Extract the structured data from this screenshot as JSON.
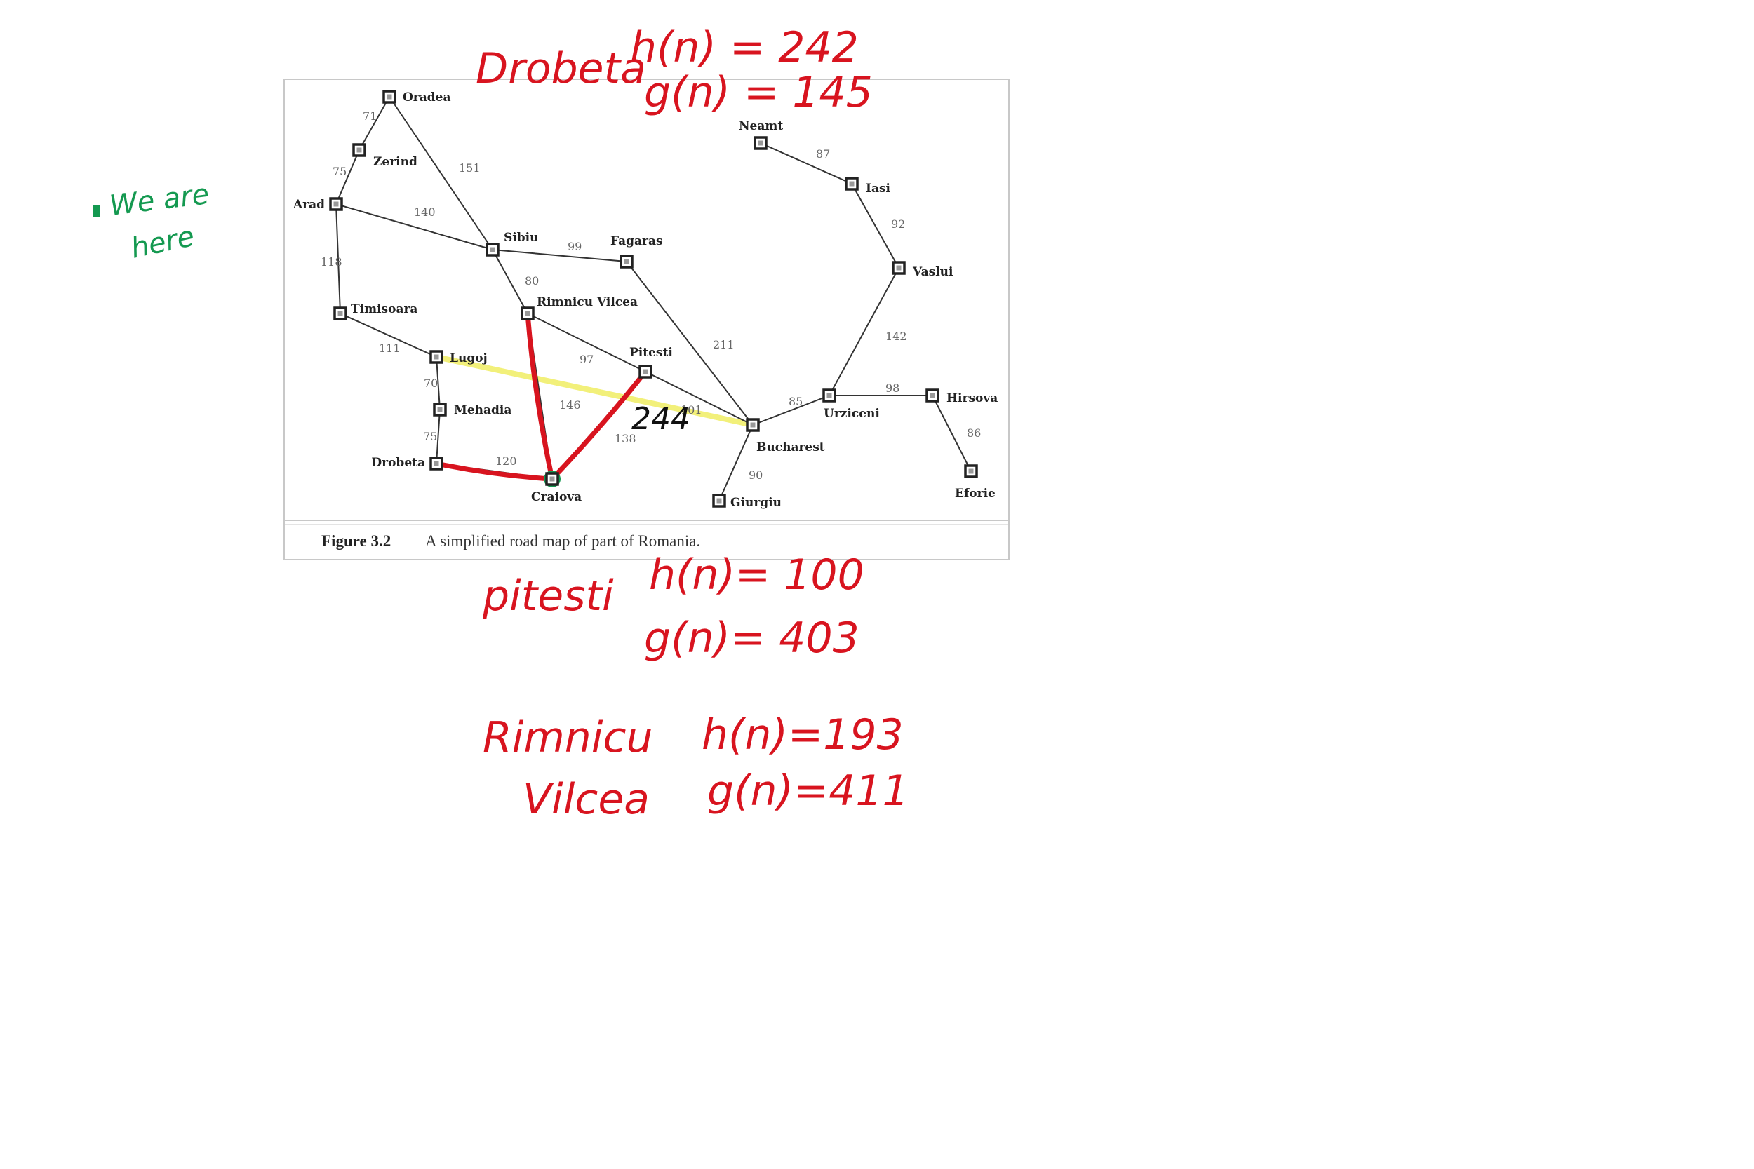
{
  "figure": {
    "number": "Figure 3.2",
    "caption": "A simplified road map of part of Romania."
  },
  "cities": [
    {
      "id": "oradea",
      "name": "Oradea"
    },
    {
      "id": "zerind",
      "name": "Zerind"
    },
    {
      "id": "arad",
      "name": "Arad"
    },
    {
      "id": "sibiu",
      "name": "Sibiu"
    },
    {
      "id": "fagaras",
      "name": "Fagaras"
    },
    {
      "id": "timisoara",
      "name": "Timisoara"
    },
    {
      "id": "rimnicu",
      "name": "Rimnicu Vilcea"
    },
    {
      "id": "lugoj",
      "name": "Lugoj"
    },
    {
      "id": "pitesti",
      "name": "Pitesti"
    },
    {
      "id": "mehadia",
      "name": "Mehadia"
    },
    {
      "id": "drobeta",
      "name": "Drobeta"
    },
    {
      "id": "craiova",
      "name": "Craiova"
    },
    {
      "id": "bucharest",
      "name": "Bucharest"
    },
    {
      "id": "giurgiu",
      "name": "Giurgiu"
    },
    {
      "id": "urziceni",
      "name": "Urziceni"
    },
    {
      "id": "hirsova",
      "name": "Hirsova"
    },
    {
      "id": "eforie",
      "name": "Eforie"
    },
    {
      "id": "vaslui",
      "name": "Vaslui"
    },
    {
      "id": "iasi",
      "name": "Iasi"
    },
    {
      "id": "neamt",
      "name": "Neamt"
    }
  ],
  "roads": [
    {
      "from": "oradea",
      "to": "zerind",
      "distance": "71"
    },
    {
      "from": "zerind",
      "to": "arad",
      "distance": "75"
    },
    {
      "from": "oradea",
      "to": "sibiu",
      "distance": "151"
    },
    {
      "from": "arad",
      "to": "sibiu",
      "distance": "140"
    },
    {
      "from": "arad",
      "to": "timisoara",
      "distance": "118"
    },
    {
      "from": "sibiu",
      "to": "fagaras",
      "distance": "99"
    },
    {
      "from": "sibiu",
      "to": "rimnicu",
      "distance": "80"
    },
    {
      "from": "timisoara",
      "to": "lugoj",
      "distance": "111"
    },
    {
      "from": "rimnicu",
      "to": "pitesti",
      "distance": "97"
    },
    {
      "from": "lugoj",
      "to": "mehadia",
      "distance": "70"
    },
    {
      "from": "rimnicu",
      "to": "craiova",
      "distance": "146"
    },
    {
      "from": "fagaras",
      "to": "bucharest",
      "distance": "211"
    },
    {
      "from": "pitesti",
      "to": "bucharest",
      "distance": "101"
    },
    {
      "from": "mehadia",
      "to": "drobeta",
      "distance": "75"
    },
    {
      "from": "pitesti",
      "to": "craiova",
      "distance": "138"
    },
    {
      "from": "drobeta",
      "to": "craiova",
      "distance": "120"
    },
    {
      "from": "bucharest",
      "to": "urziceni",
      "distance": "85"
    },
    {
      "from": "bucharest",
      "to": "giurgiu",
      "distance": "90"
    },
    {
      "from": "urziceni",
      "to": "hirsova",
      "distance": "98"
    },
    {
      "from": "hirsova",
      "to": "eforie",
      "distance": "86"
    },
    {
      "from": "urziceni",
      "to": "vaslui",
      "distance": "142"
    },
    {
      "from": "vaslui",
      "to": "iasi",
      "distance": "92"
    },
    {
      "from": "iasi",
      "to": "neamt",
      "distance": "87"
    }
  ],
  "highlighted_paths": {
    "red": [
      [
        "drobeta",
        "craiova"
      ],
      [
        "craiova",
        "rimnicu"
      ],
      [
        "craiova",
        "pitesti"
      ]
    ],
    "yellow": [
      [
        "lugoj",
        "bucharest"
      ]
    ],
    "current_node": "craiova"
  },
  "annotations": {
    "we_are_here_line1": "We are",
    "we_are_here_line2": "here",
    "straight_line_value": "244",
    "drobeta_name": "Drobeta",
    "drobeta_h": "h(n) = 242",
    "drobeta_g": "g(n) = 145",
    "pitesti_name": "pitesti",
    "pitesti_h": "h(n)= 100",
    "pitesti_g": "g(n)= 403",
    "rimnicu_name_1": "Rimnicu",
    "rimnicu_name_2": "Vilcea",
    "rimnicu_h": "h(n)=193",
    "rimnicu_g": "g(n)=411"
  },
  "colors": {
    "red_ink": "#d8141f",
    "green_ink": "#149950",
    "yellow_highlight": "#f2f07a",
    "road": "#333333"
  }
}
